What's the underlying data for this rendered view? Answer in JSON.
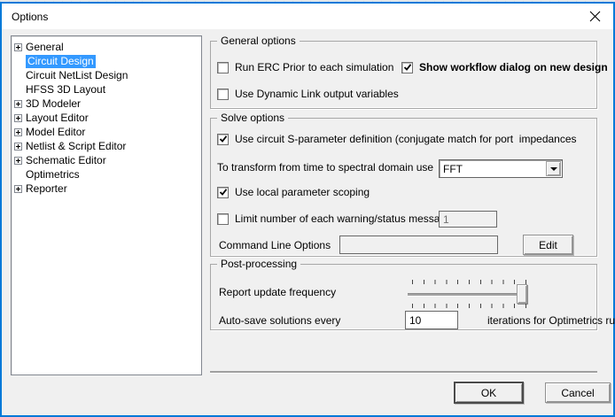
{
  "window": {
    "title": "Options"
  },
  "tree": {
    "items": [
      {
        "label": "General",
        "expandable": true,
        "selected": false
      },
      {
        "label": "Circuit Design",
        "expandable": false,
        "selected": true
      },
      {
        "label": "Circuit NetList Design",
        "expandable": false,
        "selected": false
      },
      {
        "label": "HFSS 3D Layout",
        "expandable": false,
        "selected": false
      },
      {
        "label": "3D Modeler",
        "expandable": true,
        "selected": false
      },
      {
        "label": "Layout Editor",
        "expandable": true,
        "selected": false
      },
      {
        "label": "Model Editor",
        "expandable": true,
        "selected": false
      },
      {
        "label": "Netlist & Script Editor",
        "expandable": true,
        "selected": false
      },
      {
        "label": "Schematic Editor",
        "expandable": true,
        "selected": false
      },
      {
        "label": "Optimetrics",
        "expandable": false,
        "selected": false
      },
      {
        "label": "Reporter",
        "expandable": true,
        "selected": false
      }
    ]
  },
  "groups": {
    "general": {
      "title": "General options",
      "run_erc": {
        "label": "Run ERC Prior to each simulation",
        "checked": false
      },
      "show_workflow": {
        "label": "Show workflow dialog on new design",
        "checked": true
      },
      "dynamic_link": {
        "label": "Use Dynamic Link output variables",
        "checked": false
      }
    },
    "solve": {
      "title": "Solve options",
      "s_param": {
        "label": "Use circuit S-parameter definition (conjugate match for port  impedances",
        "checked": true
      },
      "transform": {
        "label": "To transform from time to spectral domain use",
        "value": "FFT"
      },
      "local_scoping": {
        "label": "Use local parameter scoping",
        "checked": true
      },
      "limit": {
        "label": "Limit number of each warning/status message",
        "checked": false,
        "value": "1"
      },
      "command_line": {
        "label": "Command Line Options",
        "value": "",
        "edit_label": "Edit"
      }
    },
    "post": {
      "title": "Post-processing",
      "report_update": {
        "label": "Report update frequency"
      },
      "auto_save": {
        "label": "Auto-save solutions every",
        "value": "10",
        "suffix": "iterations for Optimetrics runs"
      }
    }
  },
  "footer": {
    "ok_label": "OK",
    "cancel_label": "Cancel"
  },
  "colors": {
    "accent_border": "#0079d8",
    "selection": "#3399ff",
    "dialog_bg": "#f0f0f0",
    "titlebar_bg": "#ffffff"
  }
}
